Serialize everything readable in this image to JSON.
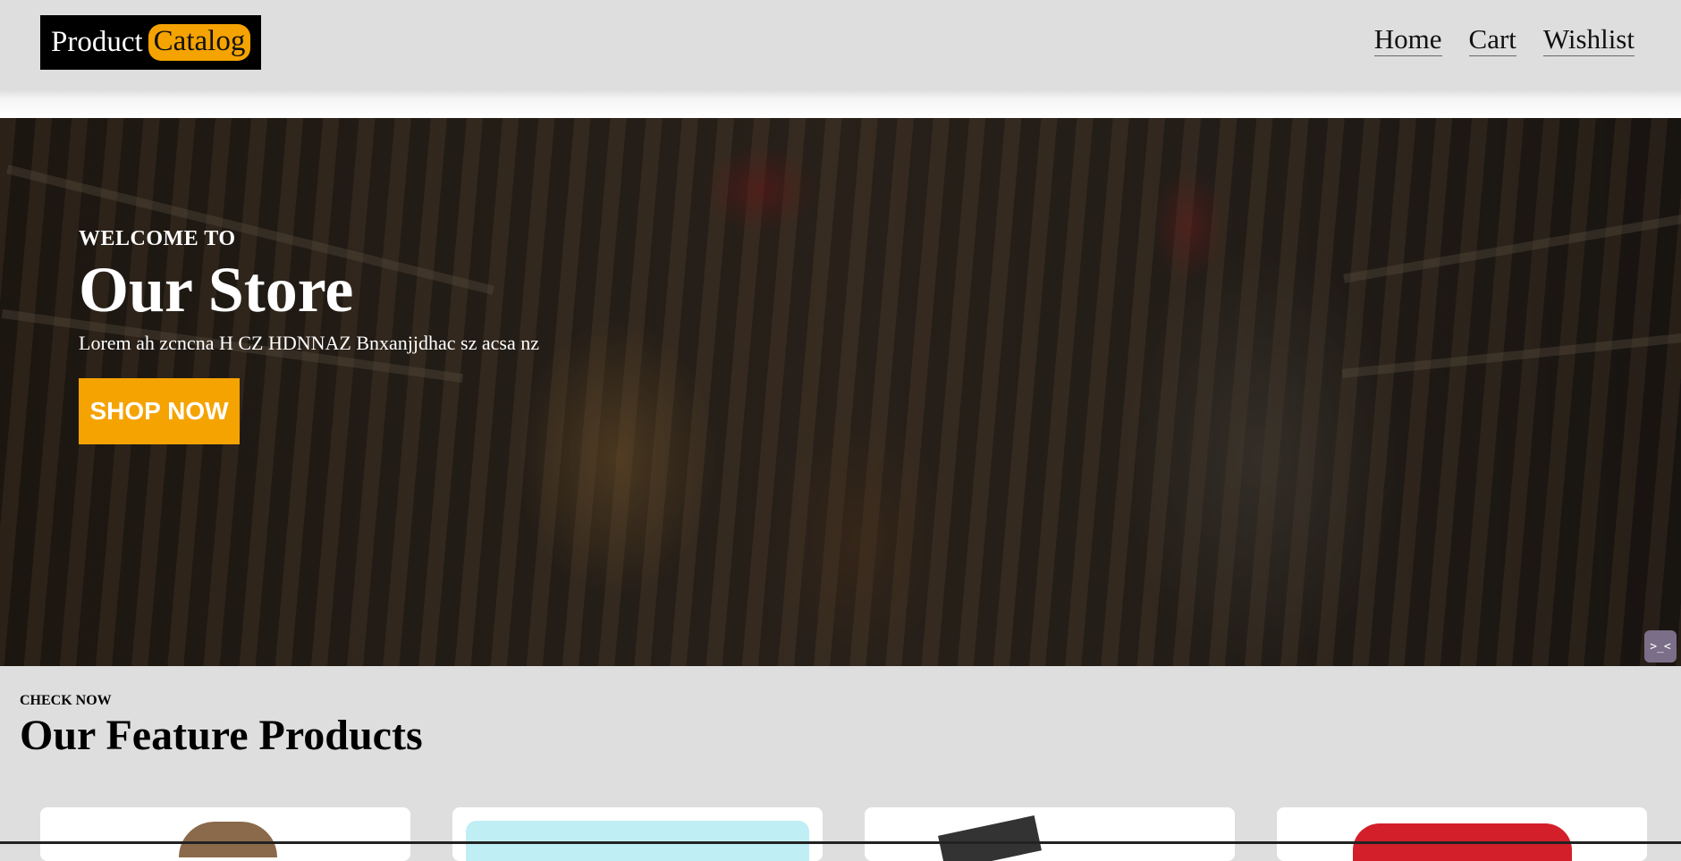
{
  "header": {
    "logo_part1": "Product",
    "logo_part2": "Catalog",
    "nav": [
      "Home",
      "Cart",
      "Wishlist"
    ]
  },
  "hero": {
    "eyebrow": "WELCOME TO",
    "title": "Our Store",
    "subtitle": "Lorem ah zcncna H CZ HDNNAZ Bnxanjjdhac sz acsa nz",
    "cta_label": "SHOP NOW",
    "widget_icon": "code-widget-icon"
  },
  "section": {
    "eyebrow": "CHECK NOW",
    "title": "Our Feature Products"
  },
  "colors": {
    "accent": "#f5a300",
    "background": "#dedede",
    "logo_bg": "#000000"
  }
}
